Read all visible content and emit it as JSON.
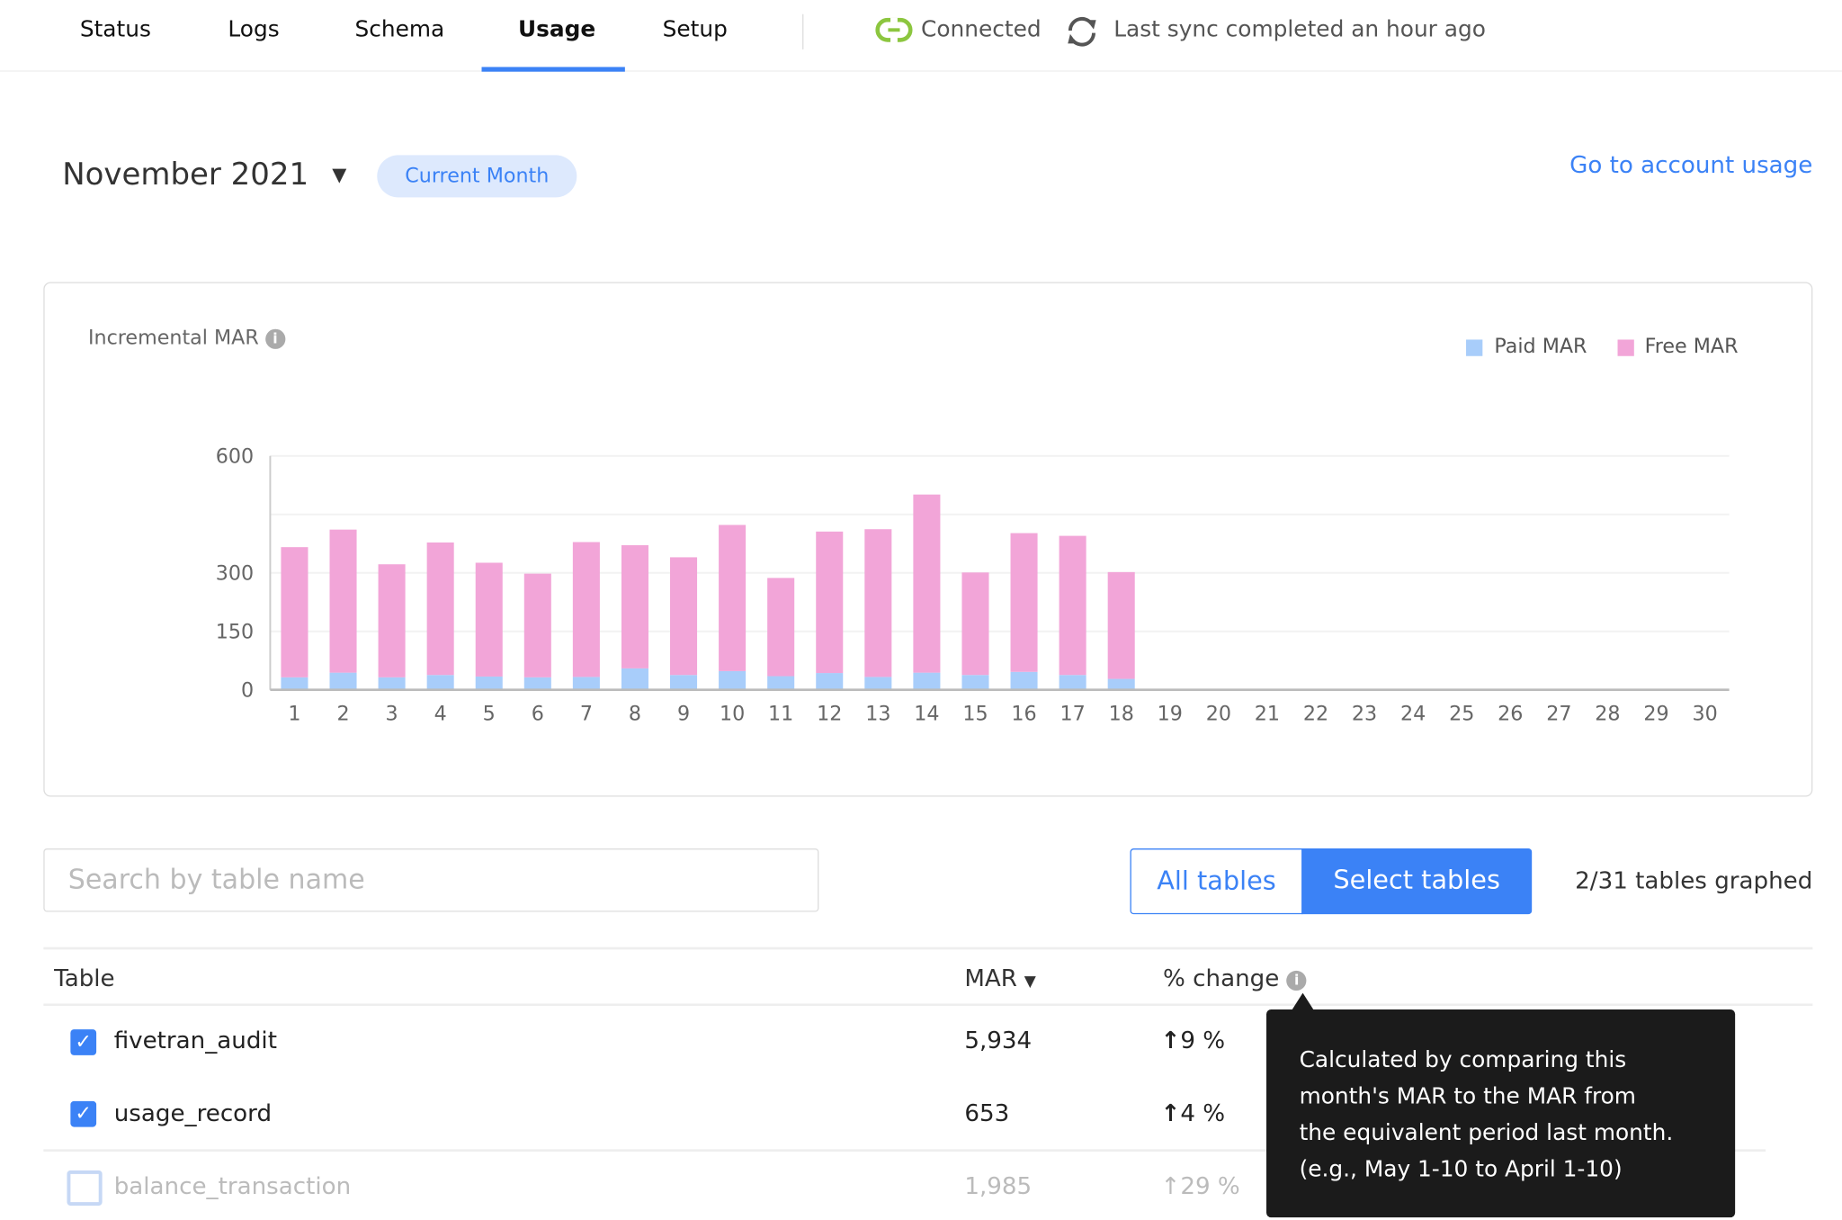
{
  "nav": {
    "tabs": [
      {
        "label": "Status"
      },
      {
        "label": "Logs"
      },
      {
        "label": "Schema"
      },
      {
        "label": "Usage",
        "active": true
      },
      {
        "label": "Setup"
      }
    ],
    "connection_status": "Connected",
    "sync_status": "Last sync completed an hour ago",
    "connected_color": "#8cc63f"
  },
  "header": {
    "month": "November 2021",
    "badge": "Current Month",
    "account_link": "Go to account usage"
  },
  "chart": {
    "title": "Incremental MAR",
    "legend": [
      {
        "label": "Paid MAR",
        "color": "#a8cdfa"
      },
      {
        "label": "Free MAR",
        "color": "#f2a5d8"
      }
    ]
  },
  "chart_data": {
    "type": "bar",
    "stacked": true,
    "title": "Incremental MAR",
    "categories": [
      "1",
      "2",
      "3",
      "4",
      "5",
      "6",
      "7",
      "8",
      "9",
      "10",
      "11",
      "12",
      "13",
      "14",
      "15",
      "16",
      "17",
      "18",
      "19",
      "20",
      "21",
      "22",
      "23",
      "24",
      "25",
      "26",
      "27",
      "28",
      "29",
      "30"
    ],
    "series": [
      {
        "name": "Paid MAR",
        "color": "#a8cdfa",
        "values": [
          32,
          44,
          32,
          38,
          34,
          32,
          33,
          55,
          38,
          48,
          35,
          43,
          33,
          44,
          38,
          46,
          38,
          28
        ]
      },
      {
        "name": "Free MAR",
        "color": "#f2a5d8",
        "values": [
          334,
          367,
          290,
          340,
          292,
          266,
          346,
          316,
          302,
          375,
          252,
          363,
          379,
          457,
          263,
          356,
          357,
          274
        ]
      }
    ],
    "yticks": [
      0,
      150,
      300,
      600
    ],
    "ylim": [
      0,
      600
    ],
    "grid": true,
    "legend_position": "top-right"
  },
  "controls": {
    "search_placeholder": "Search by table name",
    "all_tables": "All tables",
    "select_tables": "Select tables",
    "graphed_count": "2/31 tables graphed"
  },
  "table": {
    "headers": {
      "table": "Table",
      "mar": "MAR",
      "change": "% change"
    },
    "rows": [
      {
        "name": "fivetran_audit",
        "mar": "5,934",
        "change": "9 %",
        "checked": true
      },
      {
        "name": "usage_record",
        "mar": "653",
        "change": "4 %",
        "checked": true
      },
      {
        "name": "balance_transaction",
        "mar": "1,985",
        "change": "29 %",
        "checked": false
      }
    ]
  },
  "tooltip": {
    "lines": [
      "Calculated by comparing this",
      "month's MAR to the MAR from",
      "the equivalent period last month.",
      "(e.g., May 1-10 to April 1-10)"
    ]
  }
}
